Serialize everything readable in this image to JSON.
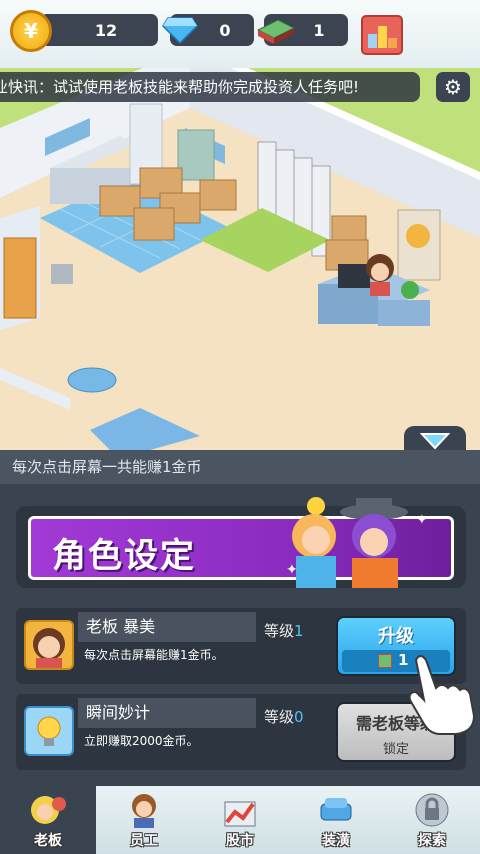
{
  "top_bar": {
    "coin_symbol": "¥",
    "coins": "12",
    "diamonds": "0",
    "cash_bundles": "1"
  },
  "news_ticker": {
    "text": "商业快讯：试试使用老板技能来帮助你完成投资人任务吧!"
  },
  "panel": {
    "earn_info": "每次点击屏幕一共能赚1金币",
    "banner_title": "角色设定",
    "rows": [
      {
        "name": "老板 暴美",
        "level_label": "等级",
        "level": "1",
        "description": "每次点击屏幕能赚1金币。",
        "button_label": "升级",
        "button_cost": "1"
      },
      {
        "name": "瞬间妙计",
        "level_label": "等级",
        "level": "0",
        "description": "立即赚取2000金币。",
        "button_label": "需老板等级",
        "button_sub": "锁定"
      }
    ]
  },
  "tabs": [
    {
      "label": "老板",
      "icon": "boss-icon",
      "active": true
    },
    {
      "label": "员工",
      "icon": "staff-icon",
      "active": false
    },
    {
      "label": "股市",
      "icon": "stock-icon",
      "active": false
    },
    {
      "label": "装潢",
      "icon": "decor-icon",
      "active": false
    },
    {
      "label": "探索",
      "icon": "lock-icon",
      "active": false
    }
  ],
  "colors": {
    "accent_blue": "#4fc3f7",
    "banner_purple": "#9b2fc9",
    "panel_dark": "#3a4350"
  }
}
